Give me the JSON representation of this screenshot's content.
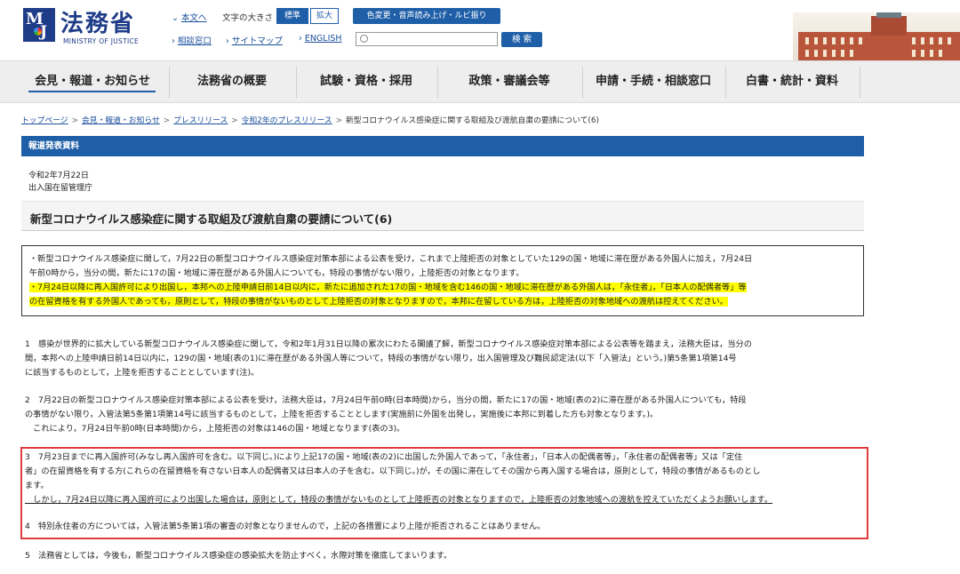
{
  "header": {
    "logo_title": "法務省",
    "logo_sub": "MINISTRY OF JUSTICE",
    "logo_mark_m": "M",
    "logo_mark_j": "J",
    "skip_link": "本文へ",
    "font_size_label": "文字の大きさ",
    "font_size_standard": "標準",
    "font_size_large": "拡大",
    "accessibility_button": "色変更・音声読み上げ・ルビ振り",
    "links": [
      "相談窓口",
      "サイトマップ",
      "ENGLISH"
    ],
    "search_placeholder": "",
    "search_button": "検 索"
  },
  "nav": {
    "items": [
      "会見・報道・お知らせ",
      "法務省の概要",
      "試験・資格・採用",
      "政策・審議会等",
      "申請・手続・相談窓口",
      "白書・統計・資料"
    ],
    "active_index": 0
  },
  "breadcrumb": {
    "links": [
      "トップページ",
      "会見・報道・お知らせ",
      "プレスリリース",
      "令和2年のプレスリリース"
    ],
    "current": "新型コロナウイルス感染症に関する取組及び渡航自粛の要請について(6)"
  },
  "press": {
    "bar_label": "報道発表資料",
    "date": "令和2年7月22日",
    "agency": "出入国在留管理庁",
    "title": "新型コロナウイルス感染症に関する取組及び渡航自粛の要請について(6)"
  },
  "notice": {
    "line1": "・新型コロナウイルス感染症に関して，7月22日の新型コロナウイルス感染症対策本部による公表を受け，これまで上陸拒否の対象としていた129の国・地域に滞在歴がある外国人に加え，7月24日",
    "line2": "午前0時から，当分の間，新たに17の国・地域に滞在歴がある外国人についても，特段の事情がない限り，上陸拒否の対象となります。",
    "line3": "・7月24日以降に再入国許可により出国し，本邦への上陸申請日前14日以内に，新たに追加された17の国・地域を含む146の国・地域に滞在歴がある外国人は，「永住者」，「日本人の配偶者等」等",
    "line4": "の在留資格を有する外国人であっても，原則として，特段の事情がないものとして上陸拒否の対象となりますので，本邦に在留している方は，上陸拒否の対象地域への渡航は控えてください。"
  },
  "body": {
    "p1": [
      "1　感染が世界的に拡大している新型コロナウイルス感染症に関して，令和2年1月31日以降の累次にわたる閣議了解，新型コロナウイルス感染症対策本部による公表等を踏まえ，法務大臣は，当分の",
      "間，本邦への上陸申請日前14日以内に，129の国・地域(表の1)に滞在歴がある外国人等について，特段の事情がない限り，出入国管理及び難民認定法(以下「入管法」という。)第5条第1項第14号",
      "に該当するものとして，上陸を拒否することとしています(注)。"
    ],
    "p2": [
      "2　7月22日の新型コロナウイルス感染症対策本部による公表を受け，法務大臣は，7月24日午前0時(日本時間)から，当分の間，新たに17の国・地域(表の2)に滞在歴がある外国人についても，特段",
      "の事情がない限り，入管法第5条第1項第14号に該当するものとして，上陸を拒否することとします(実施前に外国を出発し，実施後に本邦に到着した方も対象となります。)。",
      "　これにより，7月24日午前0時(日本時間)から，上陸拒否の対象は146の国・地域となります(表の3)。"
    ],
    "p3": [
      "3　7月23日までに再入国許可(みなし再入国許可を含む。以下同じ。)により上記17の国・地域(表の2)に出国した外国人であって，「永住者」，「日本人の配偶者等」，「永住者の配偶者等」又は「定住",
      "者」の在留資格を有する方(これらの在留資格を有さない日本人の配偶者又は日本人の子を含む。以下同じ。)が，その国に滞在してその国から再入国する場合は，原則として，特段の事情があるものとし",
      "ます。",
      "　しかし，7月24日以降に再入国許可により出国した場合は，原則として，特段の事情がないものとして上陸拒否の対象となりますので，上陸拒否の対象地域への渡航を控えていただくようお願いします。"
    ],
    "p4": "4　特別永住者の方については，入管法第5条第1項の審査の対象となりませんので，上記の各措置により上陸が拒否されることはありません。",
    "p5": "5　法務省としては，今後も，新型コロナウイルス感染症の感染拡大を防止すべく，水際対策を徹底してまいります。"
  },
  "colors": {
    "brand": "#1f5fa8",
    "highlight": "#ffff00",
    "annotation_box": "#e03b3b"
  }
}
